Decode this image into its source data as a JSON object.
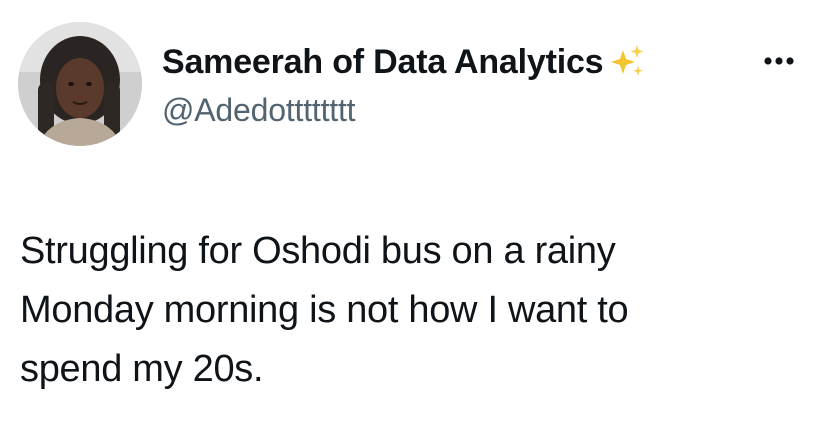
{
  "author": {
    "display_name": "Sameerah of Data Analytics",
    "name_emoji": "sparkles-icon",
    "handle": "@Adedotttttttt",
    "avatar": "avatar-photo"
  },
  "menu": {
    "icon": "more-horizontal-icon"
  },
  "tweet": {
    "lines": [
      "Struggling for Oshodi bus on a rainy",
      "Monday morning is not how I want to",
      "spend my 20s."
    ]
  },
  "colors": {
    "text": "#0f1419",
    "secondary_text": "#536471",
    "sparkle": "#f4c430"
  }
}
